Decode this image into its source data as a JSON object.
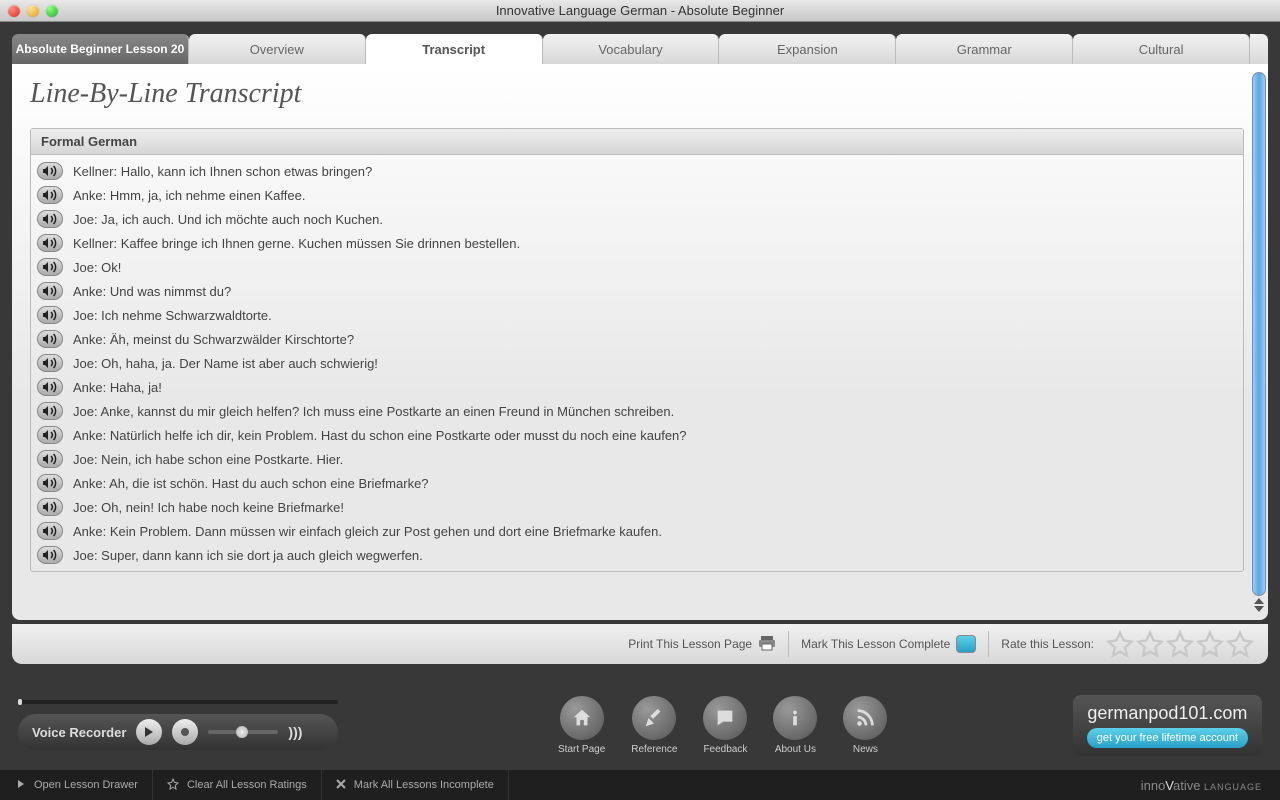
{
  "window": {
    "title": "Innovative Language German - Absolute Beginner"
  },
  "tabs": {
    "lesson": "Absolute Beginner Lesson 20",
    "items": [
      "Overview",
      "Transcript",
      "Vocabulary",
      "Expansion",
      "Grammar",
      "Cultural"
    ],
    "active": "Transcript"
  },
  "page_title": "Line-By-Line Transcript",
  "section_header": "Formal German",
  "lines": [
    "Kellner: Hallo, kann ich Ihnen schon etwas bringen?",
    "Anke: Hmm, ja, ich nehme einen Kaffee.",
    "Joe: Ja, ich auch. Und ich möchte auch noch Kuchen.",
    "Kellner: Kaffee bringe ich Ihnen gerne. Kuchen müssen Sie drinnen bestellen.",
    "Joe: Ok!",
    "Anke: Und was nimmst du?",
    "Joe: Ich nehme Schwarzwaldtorte.",
    "Anke: Äh, meinst du Schwarzwälder Kirschtorte?",
    "Joe: Oh, haha, ja. Der Name ist aber auch schwierig!",
    "Anke: Haha, ja!",
    "Joe: Anke, kannst du mir gleich helfen? Ich muss eine Postkarte an einen Freund in München schreiben.",
    "Anke: Natürlich helfe ich dir, kein Problem. Hast du schon eine Postkarte oder musst du noch eine kaufen?",
    "Joe: Nein, ich habe schon eine Postkarte. Hier.",
    "Anke: Ah, die ist schön. Hast du auch schon eine Briefmarke?",
    "Joe: Oh, nein! Ich habe noch keine Briefmarke!",
    "Anke: Kein Problem. Dann müssen wir einfach gleich zur Post gehen und dort eine Briefmarke kaufen.",
    "Joe: Super, dann kann ich sie dort ja auch gleich wegwerfen."
  ],
  "actions": {
    "print": "Print This Lesson Page",
    "complete": "Mark This Lesson Complete",
    "rate": "Rate this Lesson:"
  },
  "voice_recorder_label": "Voice Recorder",
  "nav": [
    {
      "label": "Start Page"
    },
    {
      "label": "Reference"
    },
    {
      "label": "Feedback"
    },
    {
      "label": "About Us"
    },
    {
      "label": "News"
    }
  ],
  "brand": {
    "site": "germanpod101.com",
    "cta": "get your free lifetime account"
  },
  "footer": {
    "drawer": "Open Lesson Drawer",
    "clear": "Clear All Lesson Ratings",
    "mark": "Mark All Lessons Incomplete",
    "logo_pre": "inno",
    "logo_accent": "V",
    "logo_post": "ative",
    "logo_suffix": " LANGUAGE"
  }
}
